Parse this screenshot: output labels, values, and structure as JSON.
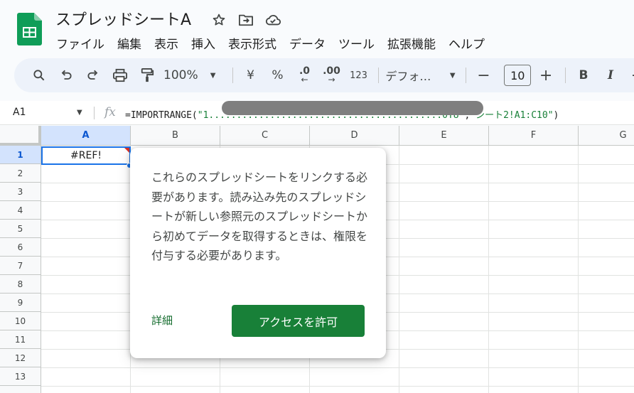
{
  "app": {
    "doc_title": "スプレッドシートA",
    "brand_color": "#0f9d58",
    "icons": [
      "star-icon",
      "move-to-folder-icon",
      "cloud-saved-icon"
    ]
  },
  "menu": [
    "ファイル",
    "編集",
    "表示",
    "挿入",
    "表示形式",
    "データ",
    "ツール",
    "拡張機能",
    "ヘルプ"
  ],
  "toolbar": {
    "zoom": "100%",
    "currency": "¥",
    "percent": "%",
    "decrease_decimal": ".0",
    "increase_decimal": ".00",
    "number_format": "123",
    "font": "デフォ…",
    "font_size": "10",
    "bold": "B",
    "italic": "I"
  },
  "formula_bar": {
    "name_box": "A1",
    "fx": "fx",
    "formula_prefix": "=IMPORTRANGE(",
    "formula_arg1": "\"1..........................................0Y8\"",
    "formula_sep": ",",
    "formula_arg2": "\"シート2!A1:C10\"",
    "formula_suffix": ")"
  },
  "grid": {
    "columns": [
      "A",
      "B",
      "C",
      "D",
      "E",
      "F",
      "G"
    ],
    "rows": [
      "1",
      "2",
      "3",
      "4",
      "5",
      "6",
      "7",
      "8",
      "9",
      "10",
      "11",
      "12",
      "13"
    ],
    "cell_a1": "#REF!"
  },
  "popup": {
    "message": "これらのスプレッドシートをリンクする必要があります。読み込み先のスプレッドシートが新しい参照元のスプレッドシートから初めてデータを取得するときは、権限を付与する必要があります。",
    "link": "詳細",
    "button": "アクセスを許可",
    "button_color": "#188038"
  }
}
